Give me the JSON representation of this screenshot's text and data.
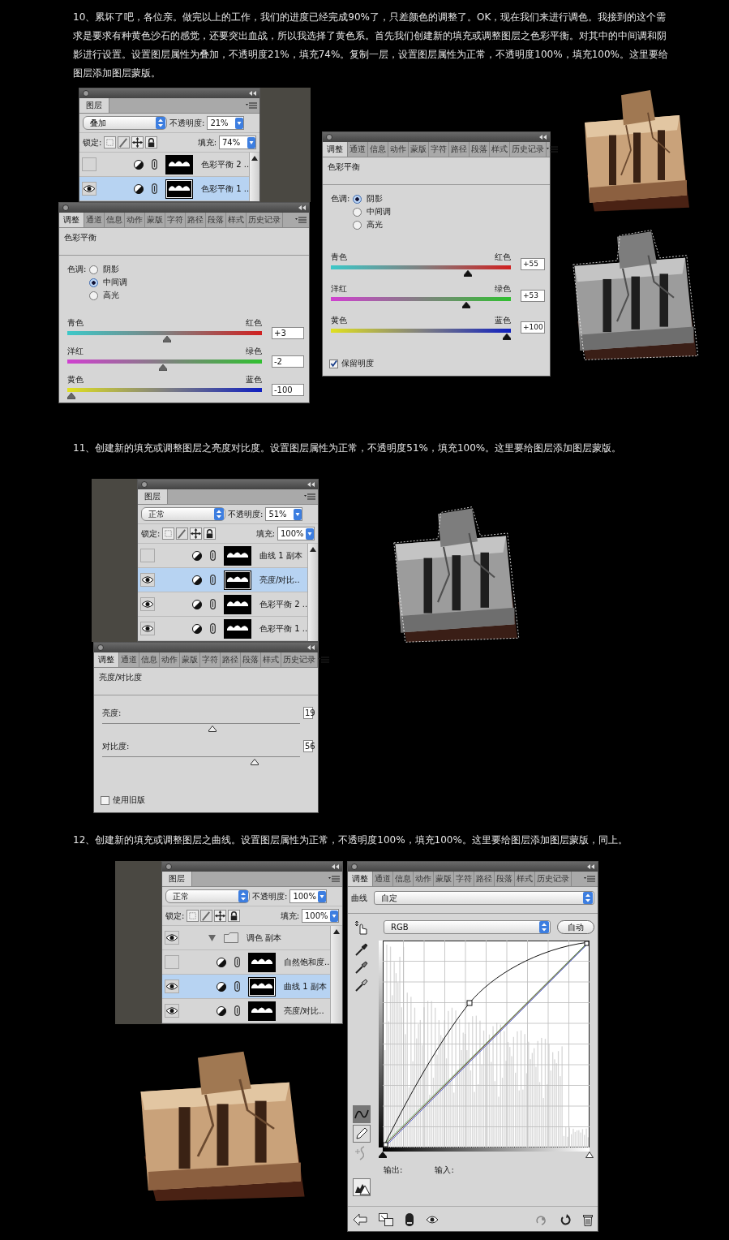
{
  "steps": [
    {
      "text": "10、累坏了吧，各位亲。做完以上的工作，我们的进度已经完成90%了，只差颜色的调整了。OK，现在我们来进行调色。我接到的这个需求是要求有种黄色沙石的感觉，还要突出血战，所以我选择了黄色系。首先我们创建新的填充或调整图层之色彩平衡。对其中的中间调和阴影进行设置。设置图层属性为叠加，不透明度21%，填充74%。复制一层，设置图层属性为正常，不透明度100%，填充100%。这里要给图层添加图层蒙版。",
      "layers_panel": {
        "tab": "图层",
        "blend_mode": "叠加",
        "opacity_label": "不透明度:",
        "opacity": "21%",
        "lock_label": "锁定:",
        "fill_label": "填充:",
        "fill": "74%",
        "layers": [
          {
            "kind": "adjustment",
            "name": "色彩平衡 2 ..",
            "visible": false,
            "selected": false
          },
          {
            "kind": "adjustment",
            "name": "色彩平衡 1 ..",
            "visible": true,
            "selected": true
          }
        ]
      },
      "adjust_panels": [
        {
          "kind": "color_balance",
          "tabs": [
            {
              "label": "调整",
              "selected": true
            },
            {
              "label": "通道",
              "selected": false
            },
            {
              "label": "信息",
              "selected": false
            },
            {
              "label": "动作",
              "selected": false
            },
            {
              "label": "蒙版",
              "selected": false
            },
            {
              "label": "字符",
              "selected": false
            },
            {
              "label": "路径",
              "selected": false
            },
            {
              "label": "段落",
              "selected": false
            },
            {
              "label": "样式",
              "selected": false
            },
            {
              "label": "历史记录",
              "selected": false
            }
          ],
          "title": "色彩平衡",
          "tone_label": "色调:",
          "tones": [
            {
              "label": "阴影",
              "selected": false
            },
            {
              "label": "中间调",
              "selected": true
            },
            {
              "label": "高光",
              "selected": false
            }
          ],
          "sliders": [
            {
              "left": "青色",
              "right": "红色",
              "value": "+3",
              "level": 0.515
            },
            {
              "left": "洋红",
              "right": "绿色",
              "value": "-2",
              "level": 0.49
            },
            {
              "left": "黄色",
              "right": "蓝色",
              "value": "-100",
              "level": 0
            }
          ]
        },
        {
          "kind": "color_balance",
          "tabs": [
            {
              "label": "调整",
              "selected": true
            },
            {
              "label": "通道",
              "selected": false
            },
            {
              "label": "信息",
              "selected": false
            },
            {
              "label": "动作",
              "selected": false
            },
            {
              "label": "蒙版",
              "selected": false
            },
            {
              "label": "字符",
              "selected": false
            },
            {
              "label": "路径",
              "selected": false
            },
            {
              "label": "段落",
              "selected": false
            },
            {
              "label": "样式",
              "selected": false
            },
            {
              "label": "历史记录",
              "selected": false
            }
          ],
          "title": "色彩平衡",
          "tone_label": "色调:",
          "tones": [
            {
              "label": "阴影",
              "selected": true
            },
            {
              "label": "中间调",
              "selected": false
            },
            {
              "label": "高光",
              "selected": false
            }
          ],
          "sliders": [
            {
              "left": "青色",
              "right": "红色",
              "value": "+55",
              "level": 0.775
            },
            {
              "left": "洋红",
              "right": "绿色",
              "value": "+53",
              "level": 0.765
            },
            {
              "left": "黄色",
              "right": "蓝色",
              "value": "+100",
              "level": 1
            }
          ],
          "preserve": {
            "label": "保留明度",
            "checked": true
          }
        }
      ]
    },
    {
      "text": "11、创建新的填充或调整图层之亮度对比度。设置图层属性为正常，不透明度51%，填充100%。这里要给图层添加图层蒙版。",
      "layers_panel": {
        "tab": "图层",
        "blend_mode": "正常",
        "opacity_label": "不透明度:",
        "opacity": "51%",
        "lock_label": "锁定:",
        "fill_label": "填充:",
        "fill": "100%",
        "layers": [
          {
            "kind": "adjustment",
            "name": "曲线 1 副本",
            "visible": false,
            "selected": false
          },
          {
            "kind": "adjustment",
            "name": "亮度/对比..",
            "visible": true,
            "selected": true
          },
          {
            "kind": "adjustment",
            "name": "色彩平衡 2 ..",
            "visible": true,
            "selected": false
          },
          {
            "kind": "adjustment",
            "name": "色彩平衡 1 ..",
            "visible": true,
            "selected": false
          }
        ]
      },
      "adjust_panels": [
        {
          "kind": "brightness_contrast",
          "tabs": [
            {
              "label": "调整",
              "selected": true
            },
            {
              "label": "通道",
              "selected": false
            },
            {
              "label": "信息",
              "selected": false
            },
            {
              "label": "动作",
              "selected": false
            },
            {
              "label": "蒙版",
              "selected": false
            },
            {
              "label": "字符",
              "selected": false
            },
            {
              "label": "路径",
              "selected": false
            },
            {
              "label": "段落",
              "selected": false
            },
            {
              "label": "样式",
              "selected": false
            },
            {
              "label": "历史记录",
              "selected": false
            }
          ],
          "title": "亮度/对比度",
          "sliders": [
            {
              "label": "亮度:",
              "value": "19",
              "level": 0.56
            },
            {
              "label": "对比度:",
              "value": "56",
              "level": 0.78
            }
          ],
          "legacy": {
            "label": "使用旧版",
            "checked": false
          }
        }
      ]
    },
    {
      "text": "12、创建新的填充或调整图层之曲线。设置图层属性为正常，不透明度100%，填充100%。这里要给图层添加图层蒙版，同上。",
      "layers_panel": {
        "tab": "图层",
        "blend_mode": "正常",
        "opacity_label": "不透明度:",
        "opacity": "100%",
        "lock_label": "锁定:",
        "fill_label": "填充:",
        "fill": "100%",
        "layers": [
          {
            "kind": "group",
            "name": "调色 副本",
            "visible": true,
            "selected": false,
            "expanded": true
          },
          {
            "kind": "adjustment",
            "name": "自然饱和度..",
            "visible": false,
            "selected": false
          },
          {
            "kind": "adjustment",
            "name": "曲线 1 副本",
            "visible": true,
            "selected": true
          },
          {
            "kind": "adjustment",
            "name": "亮度/对比..",
            "visible": true,
            "selected": false
          }
        ]
      },
      "adjust_panels": [
        {
          "kind": "curves",
          "tabs": [
            {
              "label": "调整",
              "selected": true
            },
            {
              "label": "通道",
              "selected": false
            },
            {
              "label": "信息",
              "selected": false
            },
            {
              "label": "动作",
              "selected": false
            },
            {
              "label": "蒙版",
              "selected": false
            },
            {
              "label": "字符",
              "selected": false
            },
            {
              "label": "路径",
              "selected": false
            },
            {
              "label": "段落",
              "selected": false
            },
            {
              "label": "样式",
              "selected": false
            },
            {
              "label": "历史记录",
              "selected": false
            }
          ],
          "title": "曲线",
          "preset": "自定",
          "channel": "RGB",
          "auto_button": "自动",
          "output_label": "输出:",
          "input_label": "输入:"
        }
      ]
    }
  ]
}
